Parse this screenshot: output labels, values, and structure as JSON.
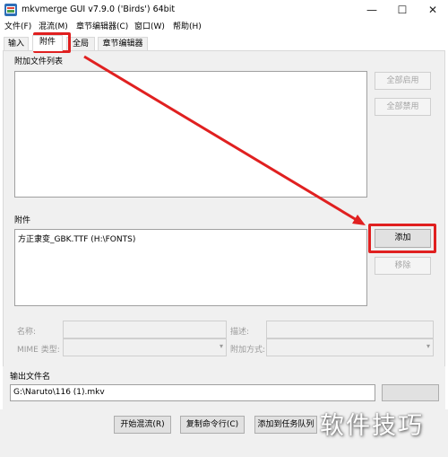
{
  "window": {
    "title": "mkvmerge GUI v7.9.0 ('Birds') 64bit",
    "minimize_glyph": "—",
    "maximize_glyph": "☐",
    "close_glyph": "✕"
  },
  "menu": {
    "items": [
      "文件(F)",
      "混流(M)",
      "章节编辑器(C)",
      "窗口(W)",
      "帮助(H)"
    ]
  },
  "tabs": [
    "输入",
    "附件",
    "全局",
    "章节编辑器"
  ],
  "attach_list": {
    "label": "附加文件列表",
    "enable_all": "全部启用",
    "disable_all": "全部禁用"
  },
  "attachments": {
    "label": "附件",
    "items": [
      "方正隶变_GBK.TTF (H:\\FONTS)"
    ],
    "add": "添加",
    "remove": "移除"
  },
  "details": {
    "name_label": "名称:",
    "desc_label": "描述:",
    "mime_label": "MIME 类型:",
    "attach_mode_label": "附加方式:"
  },
  "output": {
    "label": "输出文件名",
    "path": "G:\\Naruto\\116 (1).mkv"
  },
  "actions": {
    "start_mux": "开始混流(R)",
    "copy_cmd": "复制命令行(C)",
    "add_queue": "添加到任务队列"
  },
  "watermark": "软件技巧",
  "colors": {
    "annotation_red": "#e02020",
    "panel_bg": "#f0f0f0"
  }
}
